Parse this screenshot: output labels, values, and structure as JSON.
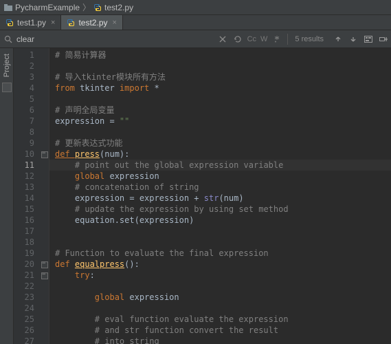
{
  "breadcrumb": {
    "project": "PycharmExample",
    "file": "test2.py"
  },
  "tabs": [
    {
      "label": "test1.py",
      "active": false
    },
    {
      "label": "test2.py",
      "active": true
    }
  ],
  "find": {
    "query": "clear",
    "results_label": "5 results",
    "case_label": "Cc",
    "word_label": "W"
  },
  "sidebar": {
    "project_label": "Project"
  },
  "editor": {
    "current_line": 11,
    "lines": [
      {
        "n": 1,
        "indent": 0,
        "tokens": [
          [
            "comment",
            "# 简易计算器"
          ]
        ]
      },
      {
        "n": 2,
        "indent": 0,
        "tokens": []
      },
      {
        "n": 3,
        "indent": 0,
        "tokens": [
          [
            "comment",
            "# 导入tkinter模块所有方法"
          ]
        ]
      },
      {
        "n": 4,
        "indent": 0,
        "tokens": [
          [
            "kw",
            "from "
          ],
          [
            "text",
            "tkinter "
          ],
          [
            "kw",
            "import "
          ],
          [
            "text",
            "*"
          ]
        ]
      },
      {
        "n": 5,
        "indent": 0,
        "tokens": []
      },
      {
        "n": 6,
        "indent": 0,
        "tokens": [
          [
            "comment",
            "# 声明全局变量"
          ]
        ]
      },
      {
        "n": 7,
        "indent": 0,
        "tokens": [
          [
            "text",
            "expression = "
          ],
          [
            "str",
            "\"\""
          ]
        ]
      },
      {
        "n": 8,
        "indent": 0,
        "tokens": []
      },
      {
        "n": 9,
        "indent": 0,
        "tokens": [
          [
            "comment",
            "# 更新表达式功能"
          ]
        ]
      },
      {
        "n": 10,
        "indent": 0,
        "fold": true,
        "tokens": [
          [
            "def-u",
            "def "
          ],
          [
            "fn-u",
            "press"
          ],
          [
            "text",
            "(num):"
          ]
        ]
      },
      {
        "n": 11,
        "indent": 1,
        "current": true,
        "tokens": [
          [
            "comment",
            "# point out the global expression variable"
          ]
        ]
      },
      {
        "n": 12,
        "indent": 1,
        "tokens": [
          [
            "kw",
            "global "
          ],
          [
            "text",
            "expression"
          ]
        ]
      },
      {
        "n": 13,
        "indent": 1,
        "tokens": [
          [
            "comment",
            "# concatenation of string"
          ]
        ]
      },
      {
        "n": 14,
        "indent": 1,
        "tokens": [
          [
            "text",
            "expression = expression + "
          ],
          [
            "builtin",
            "str"
          ],
          [
            "text",
            "(num)"
          ]
        ]
      },
      {
        "n": 15,
        "indent": 1,
        "tokens": [
          [
            "comment",
            "# update the expression by using set method"
          ]
        ]
      },
      {
        "n": 16,
        "indent": 1,
        "fold_end": true,
        "tokens": [
          [
            "text",
            "equation.set(expression)"
          ]
        ]
      },
      {
        "n": 17,
        "indent": 0,
        "tokens": []
      },
      {
        "n": 18,
        "indent": 0,
        "tokens": []
      },
      {
        "n": 19,
        "indent": 0,
        "tokens": [
          [
            "comment",
            "# Function to evaluate the final expression"
          ]
        ]
      },
      {
        "n": 20,
        "indent": 0,
        "fold": true,
        "tokens": [
          [
            "kw",
            "def "
          ],
          [
            "fn-u",
            "equalpress"
          ],
          [
            "text",
            "():"
          ]
        ]
      },
      {
        "n": 21,
        "indent": 1,
        "fold": true,
        "tokens": [
          [
            "kw",
            "try"
          ],
          [
            "text",
            ":"
          ]
        ]
      },
      {
        "n": 22,
        "indent": 0,
        "tokens": []
      },
      {
        "n": 23,
        "indent": 2,
        "tokens": [
          [
            "kw",
            "global "
          ],
          [
            "text",
            "expression"
          ]
        ]
      },
      {
        "n": 24,
        "indent": 0,
        "tokens": []
      },
      {
        "n": 25,
        "indent": 2,
        "tokens": [
          [
            "comment",
            "# eval function evaluate the expression"
          ]
        ]
      },
      {
        "n": 26,
        "indent": 2,
        "tokens": [
          [
            "comment",
            "# and str function convert the result"
          ]
        ]
      },
      {
        "n": 27,
        "indent": 2,
        "tokens": [
          [
            "comment",
            "# into string"
          ]
        ]
      }
    ]
  }
}
